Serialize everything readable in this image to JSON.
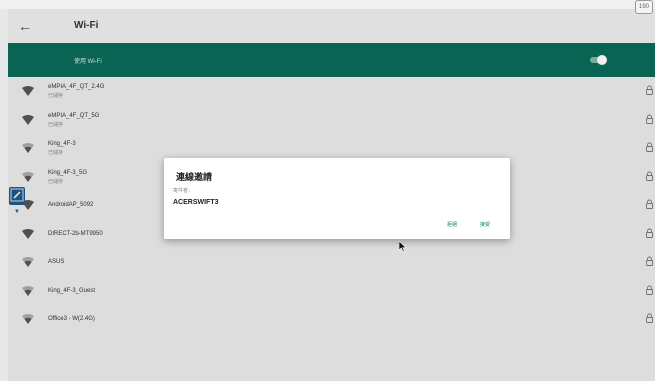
{
  "app": {
    "title": "Wi-Fi",
    "back_icon": "arrow-left-icon",
    "corner_badge": "190"
  },
  "toggle": {
    "label": "使用 Wi-Fi",
    "state": "on",
    "accent": "#0b6b59"
  },
  "networks": [
    {
      "ssid": "eMPIA_4F_QT_2.4G",
      "status": "已儲存",
      "signal": "full",
      "locked": true
    },
    {
      "ssid": "eMPIA_4F_QT_5G",
      "status": "已儲存",
      "signal": "full",
      "locked": true
    },
    {
      "ssid": "King_4F-3",
      "status": "已儲存",
      "signal": "partial",
      "locked": true
    },
    {
      "ssid": "King_4F-3_5G",
      "status": "已儲存",
      "signal": "partial",
      "locked": true
    },
    {
      "ssid": "AndroidAP_5092",
      "status": "",
      "signal": "full",
      "locked": true
    },
    {
      "ssid": "DIRECT-2b-MT9950",
      "status": "",
      "signal": "full",
      "locked": true
    },
    {
      "ssid": "ASUS",
      "status": "",
      "signal": "partial",
      "locked": true
    },
    {
      "ssid": "King_4F-3_Guest",
      "status": "",
      "signal": "partial",
      "locked": true
    },
    {
      "ssid": "Office3 - W(2.4G)",
      "status": "",
      "signal": "partial",
      "locked": true
    }
  ],
  "dialog": {
    "title": "連線邀請",
    "sender_label": "寄件者：",
    "sender": "ACERSWIFT3",
    "decline_label": "拒絕",
    "accept_label": "接受"
  }
}
